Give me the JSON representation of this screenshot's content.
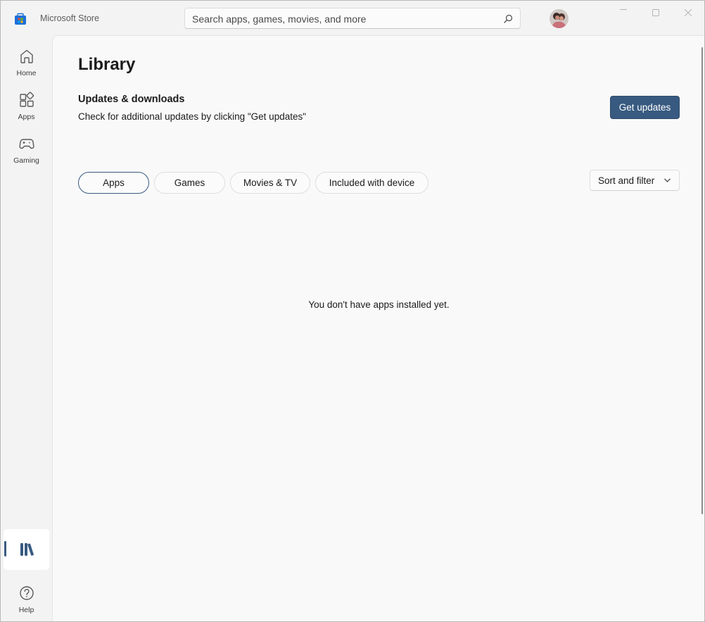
{
  "app": {
    "title": "Microsoft Store"
  },
  "search": {
    "placeholder": "Search apps, games, movies, and more"
  },
  "sidebar": {
    "items": [
      {
        "label": "Home",
        "icon": "home-icon"
      },
      {
        "label": "Apps",
        "icon": "apps-icon"
      },
      {
        "label": "Gaming",
        "icon": "gaming-icon"
      },
      {
        "label": "",
        "icon": "library-icon",
        "selected": true
      },
      {
        "label": "Help",
        "icon": "help-icon"
      }
    ]
  },
  "page": {
    "title": "Library",
    "section_title": "Updates & downloads",
    "section_desc": "Check for additional updates by clicking \"Get updates\"",
    "get_updates_label": "Get updates",
    "filters": [
      "Apps",
      "Games",
      "Movies & TV",
      "Included with device"
    ],
    "active_filter": "Apps",
    "sort_label": "Sort and filter",
    "empty_message": "You don't have apps installed yet."
  },
  "colors": {
    "accent": "#385a80",
    "background": "#f3f3f3",
    "content_background": "#f9f9f9"
  }
}
